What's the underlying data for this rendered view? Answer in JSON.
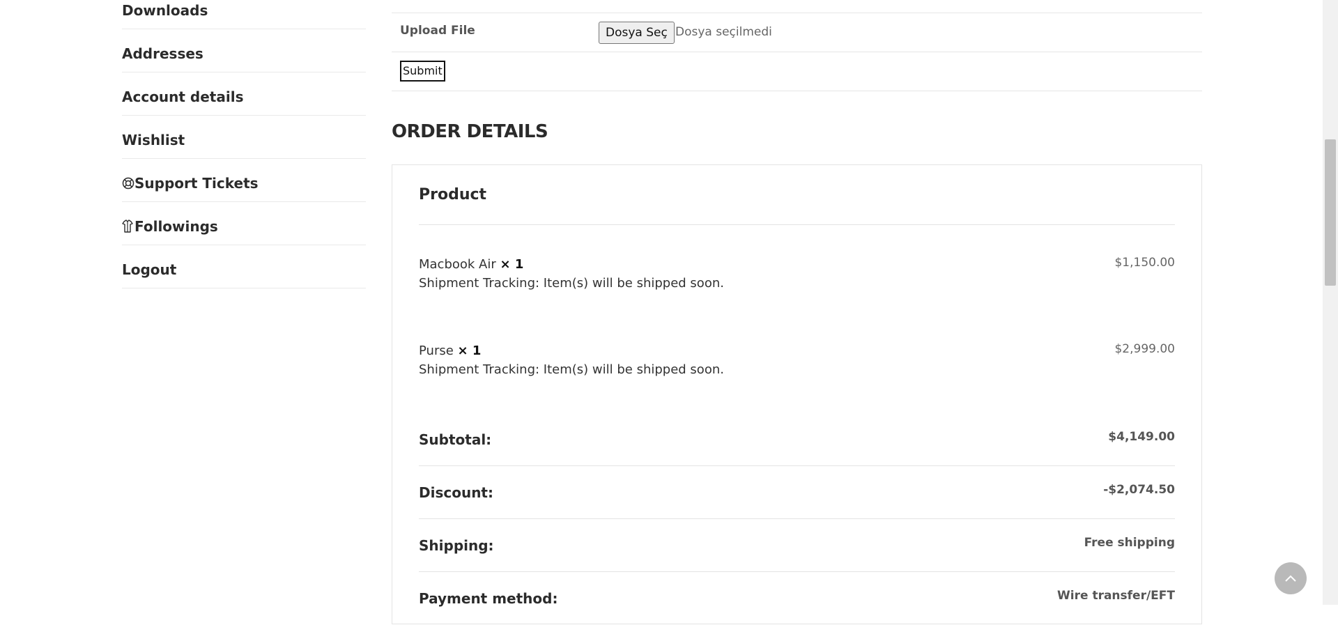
{
  "sidebar": {
    "items": [
      {
        "label": "Downloads"
      },
      {
        "label": "Addresses"
      },
      {
        "label": "Account details"
      },
      {
        "label": "Wishlist"
      },
      {
        "label": "Support Tickets",
        "icon": "lifebuoy-icon"
      },
      {
        "label": "Followings",
        "icon": "storefront-icon"
      },
      {
        "label": "Logout"
      }
    ]
  },
  "upload": {
    "label": "Upload File",
    "button_label": "Dosya Seç",
    "status": "Dosya seçilmedi"
  },
  "submit_label": "Submit",
  "order": {
    "title": "ORDER DETAILS",
    "product_header": "Product",
    "items": [
      {
        "name": "Macbook Air",
        "qty": "× 1",
        "tracking": "Shipment Tracking: Item(s) will be shipped soon.",
        "price": "$1,150.00"
      },
      {
        "name": "Purse",
        "qty": "× 1",
        "tracking": "Shipment Tracking: Item(s) will be shipped soon.",
        "price": "$2,999.00"
      }
    ],
    "totals": [
      {
        "label": "Subtotal:",
        "value": "$4,149.00"
      },
      {
        "label": "Discount:",
        "value": "-$2,074.50"
      },
      {
        "label": "Shipping:",
        "value": "Free shipping"
      },
      {
        "label": "Payment method:",
        "value": "Wire transfer/EFT"
      }
    ]
  },
  "colors": {
    "text": "#2b2b2b",
    "border": "#e3e3e3",
    "scroll_top_button": "#b9b9b9"
  }
}
